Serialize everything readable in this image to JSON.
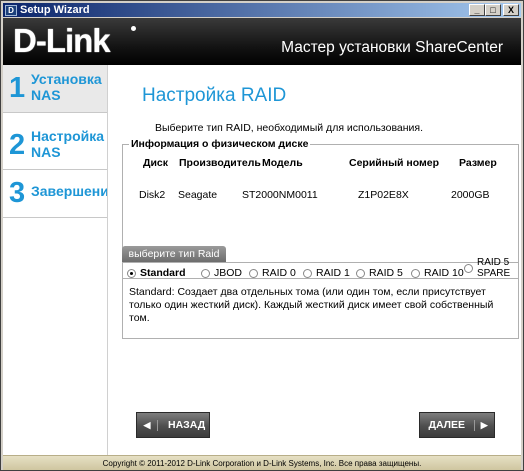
{
  "window": {
    "title": "Setup Wizard",
    "app_icon": "D",
    "minimize_icon": "_",
    "maximize_icon": "□",
    "close_icon": "X"
  },
  "header": {
    "logo": "D-Link",
    "title": "Мастер установки ShareCenter"
  },
  "sidebar": {
    "items": [
      {
        "number": "1",
        "label_line1": "Установка",
        "label_line2": "NAS"
      },
      {
        "number": "2",
        "label_line1": "Настройка",
        "label_line2": "NAS"
      },
      {
        "number": "3",
        "label_line1": "Завершени",
        "label_line2": ""
      }
    ]
  },
  "main": {
    "title": "Настройка RAID",
    "instruction": "Выберите тип RAID, необходимый для использования.",
    "disk_info": {
      "legend": "Информация о физическом диске",
      "headers": {
        "disk": "Диск",
        "vendor": "Производитель",
        "model": "Модель",
        "serial": "Серийный номер",
        "size": "Размер"
      },
      "rows": [
        {
          "disk": "Disk2",
          "vendor": "Seagate",
          "model": "ST2000NM0011",
          "serial": "Z1P02E8X",
          "size": "2000GB"
        }
      ]
    },
    "raid": {
      "header": "выберите тип Raid",
      "options": [
        {
          "label": "Standard",
          "checked": true
        },
        {
          "label": "JBOD",
          "checked": false
        },
        {
          "label": "RAID 0",
          "checked": false
        },
        {
          "label": "RAID 1",
          "checked": false
        },
        {
          "label": "RAID 5",
          "checked": false
        },
        {
          "label": "RAID 10",
          "checked": false
        },
        {
          "label_line1": "RAID 5",
          "label_line2": "SPARE",
          "checked": false
        }
      ],
      "description": "Standard: Создает два отдельных тома (или один том, если присутствует только один жесткий диск). Каждый жесткий диск имеет свой собственный том."
    }
  },
  "buttons": {
    "back": "НАЗАД",
    "next": "ДАЛЕЕ",
    "back_arrow": "◀",
    "next_arrow": "▶"
  },
  "footer": {
    "copyright": "Copyright © 2011-2012 D-Link Corporation и D-Link Systems, Inc. Все права защищены."
  }
}
